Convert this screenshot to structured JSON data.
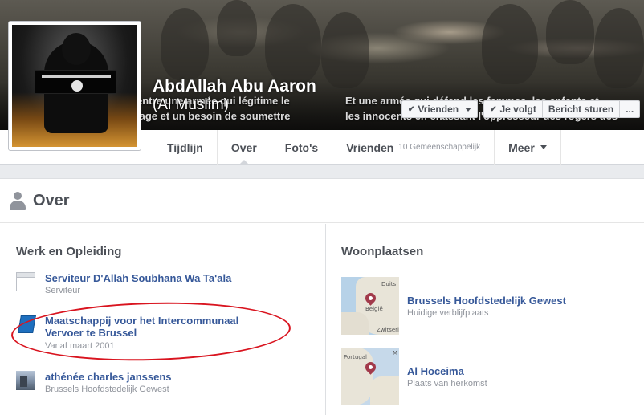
{
  "profile": {
    "name": "AbdAllah Abu Aaron",
    "alt_name": "(Al Muslim)"
  },
  "cover": {
    "caption_left": "entre une armée qui légitime le\nlage et un besoin de soumettre",
    "caption_right": "Et une armée qui défend les femmes, les enfants et\nles innocents en chassant l'oppresseur des rogers des"
  },
  "actions": {
    "friends_label": "Vrienden",
    "following_label": "Je volgt",
    "message_label": "Bericht sturen",
    "more_label": "..."
  },
  "nav": {
    "tabs": [
      {
        "label": "Tijdlijn"
      },
      {
        "label": "Over"
      },
      {
        "label": "Foto's"
      },
      {
        "label": "Vrienden",
        "sub": "10 Gemeenschappelijk"
      },
      {
        "label": "Meer"
      }
    ]
  },
  "about": {
    "title": "Over",
    "work": {
      "title": "Werk en Opleiding",
      "items": [
        {
          "title": "Serviteur D'Allah Soubhana Wa Ta'ala",
          "sub": "Serviteur"
        },
        {
          "title": "Maatschappij voor het Intercommunaal Vervoer te Brussel",
          "sub": "Vanaf maart 2001"
        },
        {
          "title": "athénée charles janssens",
          "sub": "Brussels Hoofdstedelijk Gewest"
        }
      ]
    },
    "places": {
      "title": "Woonplaatsen",
      "items": [
        {
          "title": "Brussels Hoofdstedelijk Gewest",
          "sub": "Huidige verblijfplaats",
          "map_labels": [
            "Duits",
            "België",
            "Zwitserland"
          ]
        },
        {
          "title": "Al Hoceima",
          "sub": "Plaats van herkomst",
          "map_labels": [
            "Portugal",
            "M"
          ]
        }
      ]
    }
  }
}
